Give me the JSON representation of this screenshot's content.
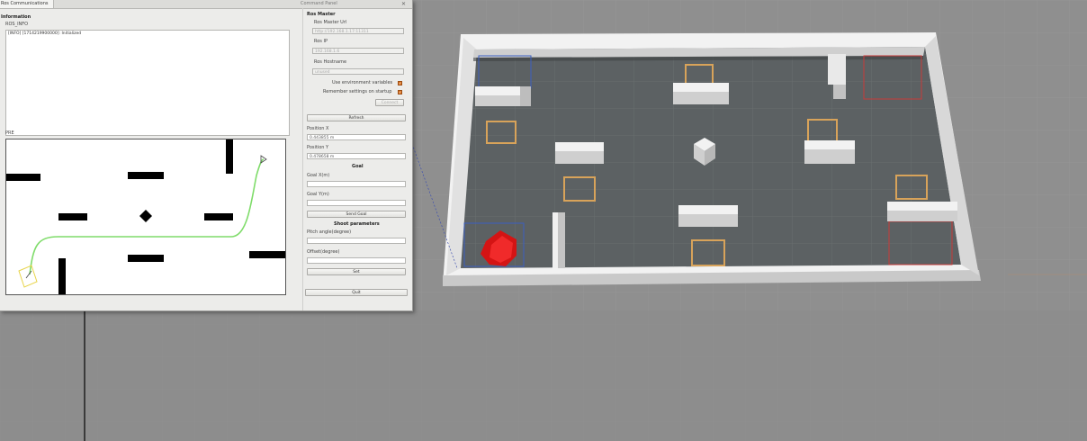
{
  "tabs": {
    "ros_communications": "Ros Communications"
  },
  "dock": {
    "title": "Command Panel",
    "close_label": "✕"
  },
  "logging": {
    "title": "Information",
    "group": "ROS_INFO",
    "log_line": "[INFO] [1714219900000]: Initialized"
  },
  "map": {
    "title": "PRE"
  },
  "ros_master": {
    "heading": "Ros Master",
    "master_url_label": "Ros Master Url",
    "master_url_value": "http://192.168.1.17:11311",
    "ip_label": "Ros IP",
    "ip_value": "192.168.1.6",
    "hostname_label": "Ros Hostname",
    "hostname_value": "unused",
    "use_env_label": "Use environment variables",
    "remember_label": "Remember settings on startup",
    "connect_label": "Connect"
  },
  "position": {
    "refresh_label": "Refresh",
    "x_label": "Position X",
    "x_value": "0.443855 m",
    "y_label": "Position Y",
    "y_value": "0.478658 m"
  },
  "goal": {
    "heading": "Goal",
    "x_label": "Goal X(m)",
    "y_label": "Goal Y(m)",
    "send_label": "Send Goal"
  },
  "shoot": {
    "heading": "Shoot parameters",
    "pitch_label": "Pitch angle(degree)",
    "offset_label": "Offset(degree)",
    "set_label": "Set"
  },
  "quit_label": "Quit"
}
